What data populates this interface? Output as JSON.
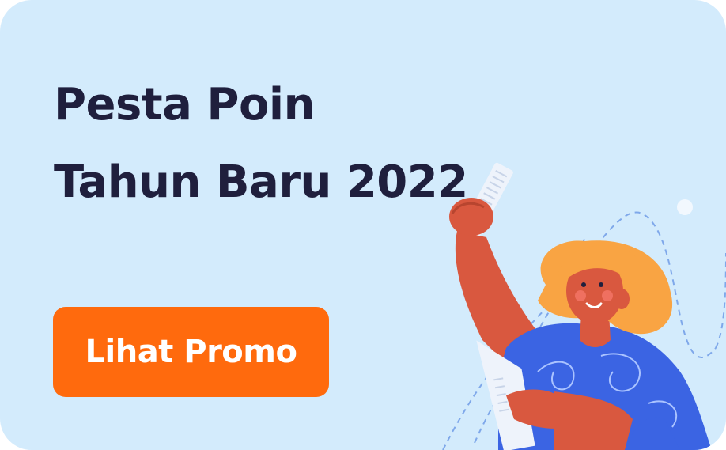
{
  "banner": {
    "title_line1": "Pesta Poin",
    "title_line2": "Tahun Baru 2022",
    "cta_label": "Lihat Promo"
  },
  "colors": {
    "background": "#d3ebfc",
    "title": "#1f1f3d",
    "cta_background": "#ff6a0d",
    "cta_text": "#ffffff",
    "skin": "#d9583f",
    "hair": "#f9a443",
    "shirt": "#3b64e3"
  },
  "icons": {
    "illustration": "woman-holding-receipt-illustration",
    "decor": "dashed-curve-decoration"
  }
}
